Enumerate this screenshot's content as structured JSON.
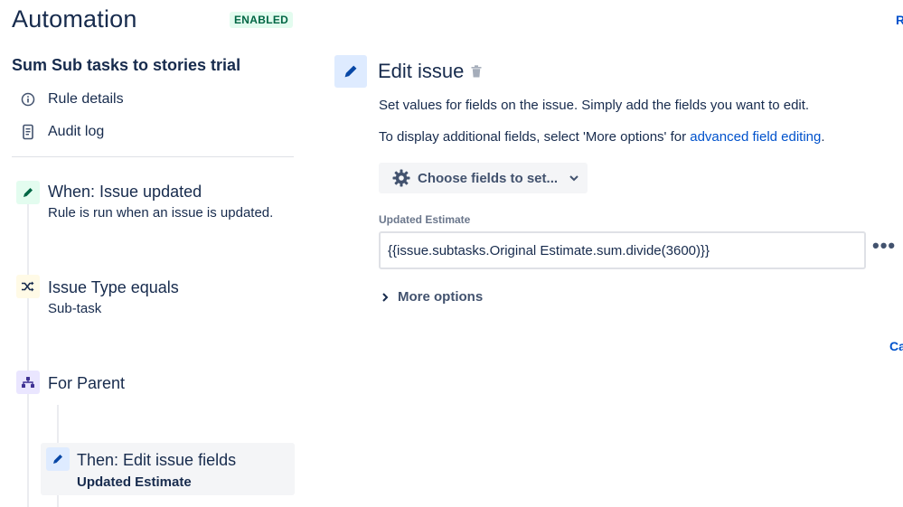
{
  "header": {
    "title": "Automation",
    "status_badge": "ENABLED",
    "edge_top": "R",
    "edge_cancel": "Ca"
  },
  "sidebar": {
    "rule_name": "Sum Sub tasks to stories trial",
    "links": [
      {
        "label": "Rule details",
        "icon": "info-icon"
      },
      {
        "label": "Audit log",
        "icon": "document-icon"
      }
    ],
    "steps": [
      {
        "title": "When: Issue updated",
        "subtitle": "Rule is run when an issue is updated.",
        "icon": "pencil-icon",
        "color": "#e3fcef"
      },
      {
        "title": "Issue Type equals",
        "subtitle": "Sub-task",
        "icon": "shuffle-icon",
        "color": "#fffae6"
      },
      {
        "title": "For Parent",
        "subtitle": "",
        "icon": "hierarchy-icon",
        "color": "#eae6ff"
      },
      {
        "title": "Then: Edit issue fields",
        "subtitle": "Updated Estimate",
        "icon": "pencil-icon",
        "color": "#deebff"
      }
    ]
  },
  "panel": {
    "title": "Edit issue",
    "description": "Set values for fields on the issue. Simply add the fields you want to edit.",
    "additional_prefix": "To display additional fields, select 'More options' for ",
    "additional_link": "advanced field editing",
    "additional_suffix": ".",
    "choose_fields_label": "Choose fields to set...",
    "field_label": "Updated Estimate",
    "field_value": "{{issue.subtasks.Original Estimate.sum.divide(3600)}}",
    "more_dots": "•••",
    "more_options_label": "More options"
  },
  "colors": {
    "accent": "#0052cc",
    "enabled_bg": "#e3fcef",
    "enabled_text": "#006644"
  }
}
